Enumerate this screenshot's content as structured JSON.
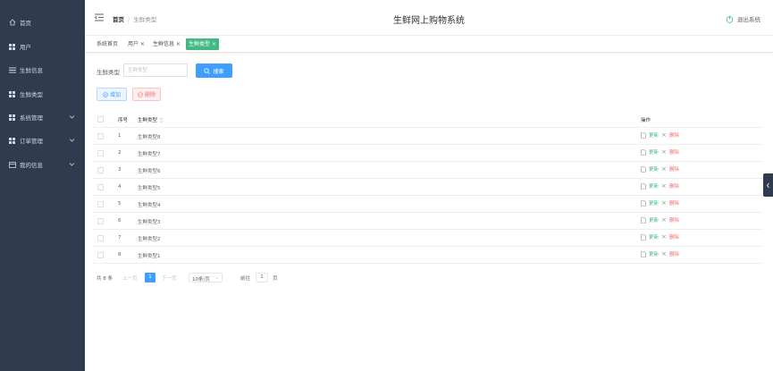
{
  "sidebar": {
    "items": [
      {
        "label": "首页",
        "icon": "home-icon"
      },
      {
        "label": "用户",
        "icon": "grid-icon"
      },
      {
        "label": "生鲜信息",
        "icon": "list-icon"
      },
      {
        "label": "生鲜类型",
        "icon": "grid-icon"
      },
      {
        "label": "系统管理",
        "icon": "grid-icon",
        "expandable": true
      },
      {
        "label": "订单管理",
        "icon": "grid-icon",
        "expandable": true
      },
      {
        "label": "我的信息",
        "icon": "card-icon",
        "expandable": true
      }
    ],
    "bg_color": "#2f3b4e"
  },
  "header": {
    "breadcrumb": [
      "首页",
      "生鲜类型"
    ],
    "title": "生鲜网上购物系统",
    "logout_label": "退出系统"
  },
  "tags": [
    {
      "label": "系统首页"
    },
    {
      "label": "用户 ×"
    },
    {
      "label": "生鲜信息 ×"
    },
    {
      "label": "生鲜类型 ×",
      "active": true
    }
  ],
  "search": {
    "label": "生鲜类型",
    "placeholder": "生鲜类型",
    "value": "",
    "button_label": "搜索"
  },
  "actions": {
    "add_label": "增加",
    "delete_label": "删除"
  },
  "table": {
    "headers": {
      "index": "序号",
      "name": "生鲜类型",
      "ops": "操作"
    },
    "rows": [
      {
        "index": "1",
        "name": "生鲜类型8"
      },
      {
        "index": "2",
        "name": "生鲜类型7"
      },
      {
        "index": "3",
        "name": "生鲜类型6"
      },
      {
        "index": "4",
        "name": "生鲜类型5"
      },
      {
        "index": "5",
        "name": "生鲜类型4"
      },
      {
        "index": "6",
        "name": "生鲜类型3"
      },
      {
        "index": "7",
        "name": "生鲜类型2"
      },
      {
        "index": "8",
        "name": "生鲜类型1"
      }
    ],
    "op_update": "更新",
    "op_delete": "删除"
  },
  "pagination": {
    "total": "共 8 条",
    "prev": "上一页",
    "current": "1",
    "next": "下一页",
    "page_size": "10条/页",
    "goto": "前往",
    "goto_value": "1",
    "page_unit": "页"
  },
  "colors": {
    "accent": "#409eff",
    "success": "#42b983",
    "danger": "#f56c6c"
  }
}
